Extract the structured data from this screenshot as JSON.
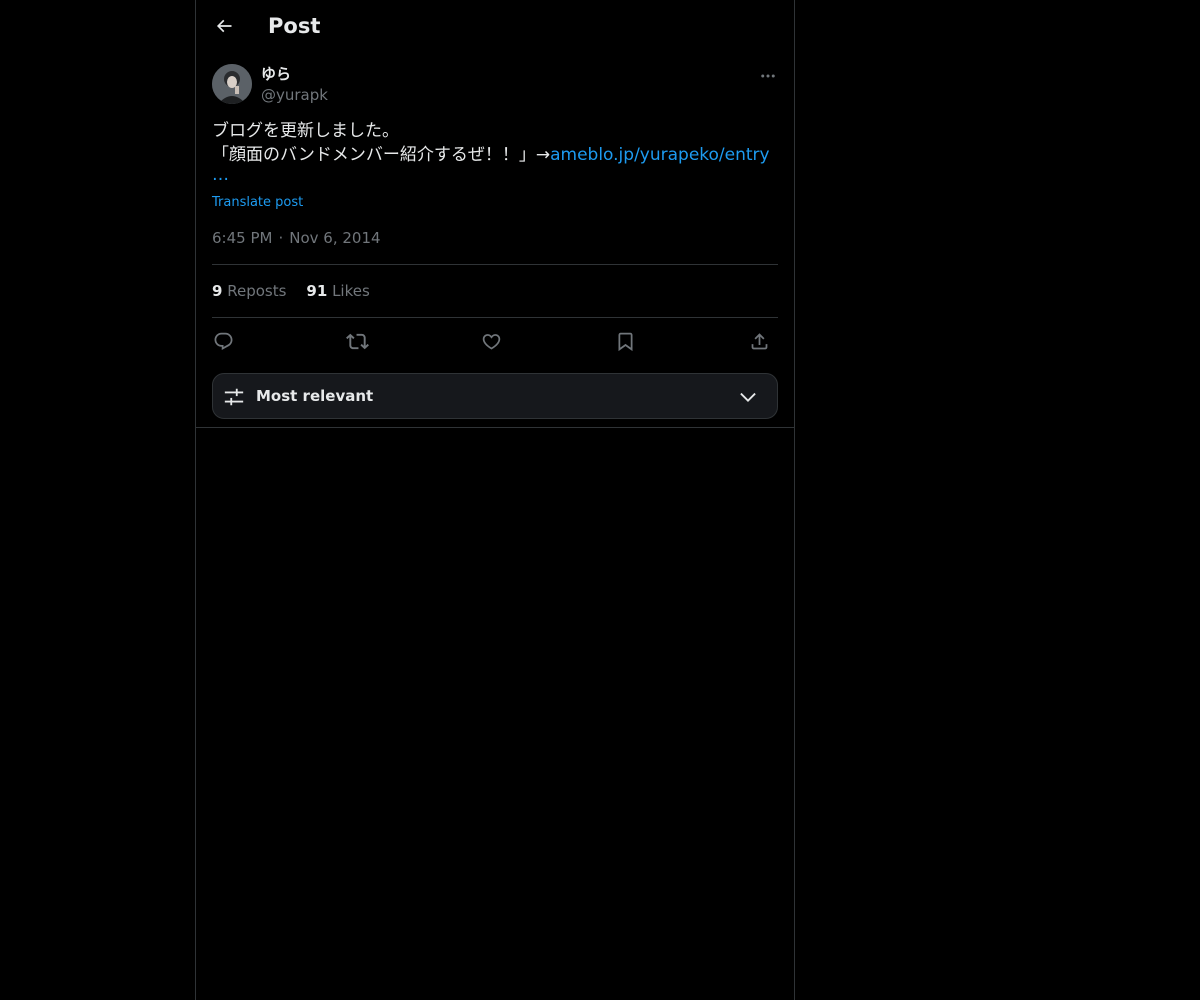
{
  "header": {
    "title": "Post",
    "back_icon": "arrow-left-icon"
  },
  "author": {
    "display_name": "ゆら",
    "handle": "@yurapk",
    "avatar_icon": "avatar"
  },
  "post": {
    "line1": "ブログを更新しました。",
    "line2_text": "「顔面のバンドメンバー紹介するぜ！！」→",
    "link_text": "ameblo.jp/yurapeko/entry",
    "ellipsis": "…",
    "translate_label": "Translate post",
    "time": "6:45 PM",
    "separator": "·",
    "date": "Nov 6, 2014"
  },
  "stats": {
    "reposts_count": "9",
    "reposts_label": "Reposts",
    "likes_count": "91",
    "likes_label": "Likes"
  },
  "actions": {
    "reply_icon": "reply-icon",
    "repost_icon": "repost-icon",
    "like_icon": "heart-icon",
    "bookmark_icon": "bookmark-icon",
    "share_icon": "share-icon"
  },
  "sort": {
    "label": "Most relevant",
    "icon": "sliders-icon",
    "chevron": "chevron-down-icon"
  },
  "colors": {
    "background": "#000000",
    "text_primary": "#e7e9ea",
    "text_secondary": "#71767b",
    "accent": "#1d9bf0",
    "border": "#2f3336"
  }
}
